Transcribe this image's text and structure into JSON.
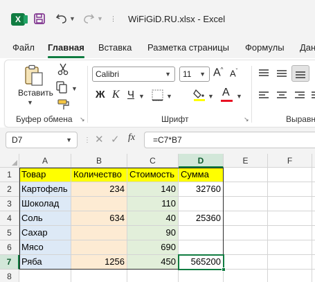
{
  "title_bar": {
    "document_title": "WiFiGiD.RU.xlsx  -  Excel"
  },
  "ribbon_tabs": [
    "Файл",
    "Главная",
    "Вставка",
    "Разметка страницы",
    "Формулы",
    "Дан"
  ],
  "ribbon": {
    "clipboard": {
      "paste_label": "Вставить",
      "group_label": "Буфер обмена"
    },
    "font": {
      "font_name": "Calibri",
      "font_size": "11",
      "bold_glyph": "Ж",
      "italic_glyph": "К",
      "underline_glyph": "Ч",
      "font_color_glyph": "А",
      "grow_glyph": "A",
      "shrink_glyph": "A",
      "group_label": "Шрифт"
    },
    "alignment": {
      "group_label": "Выравни"
    }
  },
  "formula_bar": {
    "name_box": "D7",
    "fx": "fx",
    "formula": "=C7*B7"
  },
  "sheet": {
    "column_headers": [
      "A",
      "B",
      "C",
      "D",
      "E",
      "F"
    ],
    "row_headers": [
      "1",
      "2",
      "3",
      "4",
      "5",
      "6",
      "7",
      "8"
    ],
    "selected_cell": "D7",
    "rows": [
      [
        "Товар",
        "Количество",
        "Стоимость",
        "Сумма"
      ],
      [
        "Картофель",
        "234",
        "140",
        "32760"
      ],
      [
        "Шоколад",
        "",
        "110",
        ""
      ],
      [
        "Соль",
        "634",
        "40",
        "25360"
      ],
      [
        "Сахар",
        "",
        "90",
        ""
      ],
      [
        "Мясо",
        "",
        "690",
        ""
      ],
      [
        "Ряба",
        "1256",
        "450",
        "565200"
      ]
    ]
  },
  "colors": {
    "accent": "#107c41",
    "header_fill": "#ffff00",
    "col_a_fill": "#dde9f6",
    "col_b_fill": "#fdebd3",
    "col_c_fill": "#e2efda",
    "font_color_bar": "#e81123"
  }
}
